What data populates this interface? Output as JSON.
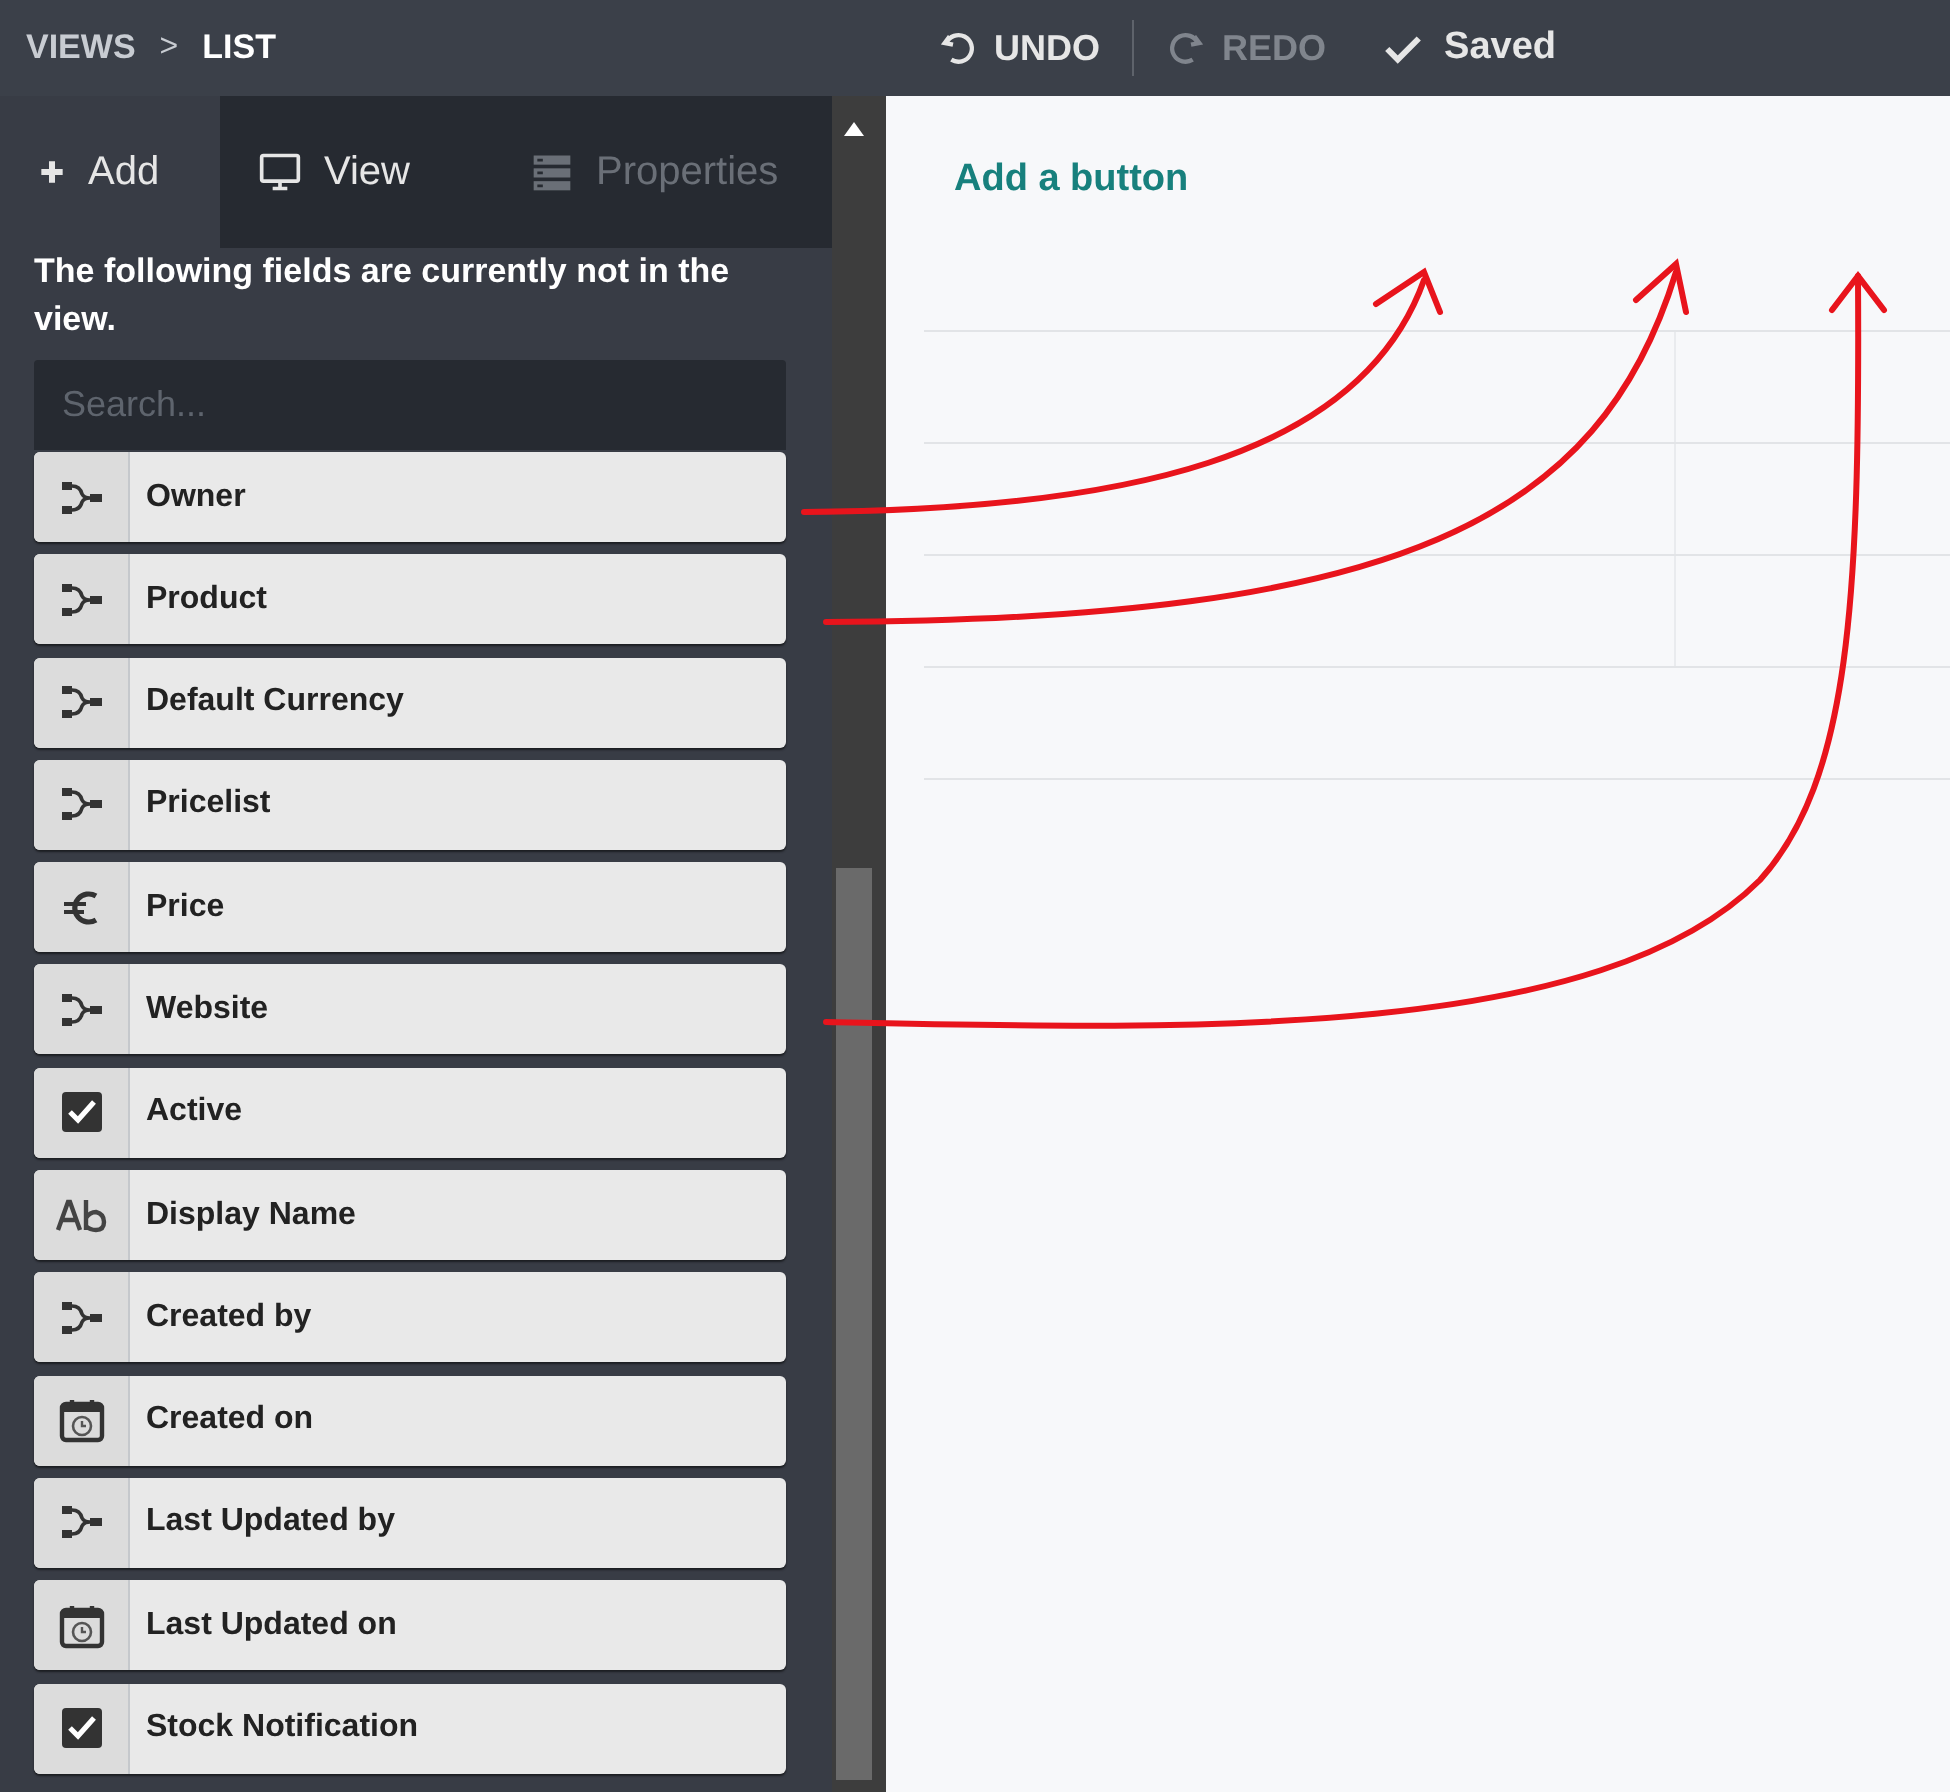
{
  "breadcrumb": [
    {
      "label": "VIEWS",
      "current": false
    },
    {
      "label": "LIST",
      "current": true
    }
  ],
  "breadcrumb_separator": ">",
  "history": [
    {
      "kind": "undo",
      "label": "UNDO",
      "disabled": false
    },
    {
      "kind": "redo",
      "label": "REDO",
      "disabled": true
    }
  ],
  "save_status": "Saved",
  "tabs": [
    {
      "kind": "add",
      "label": "Add",
      "selected": true,
      "disabled": false
    },
    {
      "kind": "view",
      "label": "View",
      "selected": false,
      "disabled": false
    },
    {
      "kind": "properties",
      "label": "Properties",
      "selected": false,
      "disabled": true
    }
  ],
  "hint": "The following fields are currently not in the view.",
  "search": {
    "placeholder": "Search..."
  },
  "fields": [
    {
      "kind": "relation",
      "label": "Owner"
    },
    {
      "kind": "relation",
      "label": "Product"
    },
    {
      "kind": "relation",
      "label": "Default Currency"
    },
    {
      "kind": "relation",
      "label": "Pricelist"
    },
    {
      "kind": "monetary",
      "label": "Price"
    },
    {
      "kind": "relation",
      "label": "Website"
    },
    {
      "kind": "boolean",
      "label": "Active"
    },
    {
      "kind": "char",
      "label": "Display Name"
    },
    {
      "kind": "relation",
      "label": "Created by"
    },
    {
      "kind": "datetime",
      "label": "Created on"
    },
    {
      "kind": "relation",
      "label": "Last Updated by"
    },
    {
      "kind": "datetime",
      "label": "Last Updated on"
    },
    {
      "kind": "boolean",
      "label": "Stock Notification"
    }
  ],
  "add_button": "Add a button"
}
